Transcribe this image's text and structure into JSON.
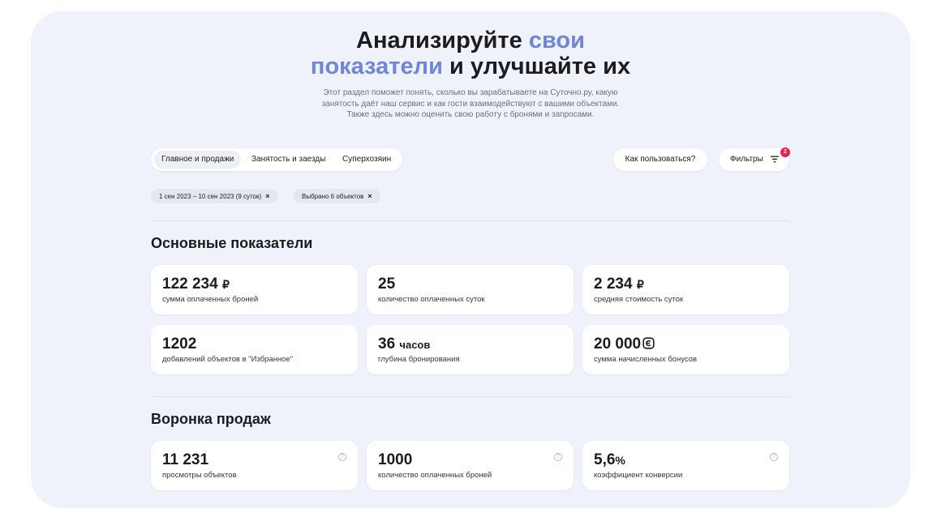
{
  "hero": {
    "title_part1": "Анализируйте ",
    "title_part2": "свои",
    "title_part3": "показатели",
    "title_part4": " и улучшайте их",
    "subtitle_line1": "Этот раздел поможет понять, сколько вы зарабатываете на Суточно.ру, какую",
    "subtitle_line2": "занятость даёт наш сервис и как гости взаимодействуют с вашими объектами.",
    "subtitle_line3": "Также здесь можно оценить свою работу с бронями и запросами."
  },
  "tabs": [
    {
      "label": "Главное и продажи",
      "active": true
    },
    {
      "label": "Занятость и заезды",
      "active": false
    },
    {
      "label": "Суперхозяин",
      "active": false
    }
  ],
  "how_to_label": "Как пользоваться?",
  "filters": {
    "label": "Фильтры",
    "badge": "2",
    "icon": "filter-icon"
  },
  "chips": [
    {
      "label": "1 сен 2023 – 10 сен 2023 (9 суток)"
    },
    {
      "label": "Выбрано 6 объектов"
    }
  ],
  "main_metrics": {
    "title": "Основные показатели",
    "cards": [
      {
        "value": "122 234",
        "unit": "₽",
        "label": "сумма оплаченных броней"
      },
      {
        "value": "25",
        "unit": "",
        "label": "количество оплаченных суток"
      },
      {
        "value": "2 234",
        "unit": "₽",
        "label": "средняя стоимость суток"
      },
      {
        "value": "1202",
        "unit": "",
        "label": "добавлений объектов в \"Избранное\""
      },
      {
        "value": "36",
        "unit": "часов",
        "label": "глубина бронирования"
      },
      {
        "value": "20 000",
        "unit": "",
        "icon": "bonus-coin-icon",
        "label": "сумма начисленных бонусов"
      }
    ]
  },
  "funnel": {
    "title": "Воронка продаж",
    "cards": [
      {
        "value": "11 231",
        "unit": "",
        "label": "просмотры объектов"
      },
      {
        "value": "1000",
        "unit": "",
        "label": "количество оплаченных броней"
      },
      {
        "value": "5,6",
        "unit": "%",
        "label": "коэффициент конверсии"
      }
    ],
    "help_glyph": "?"
  },
  "colors": {
    "accent": "#6f86d6",
    "panel": "#eff2fa",
    "badge": "#e8224a"
  }
}
